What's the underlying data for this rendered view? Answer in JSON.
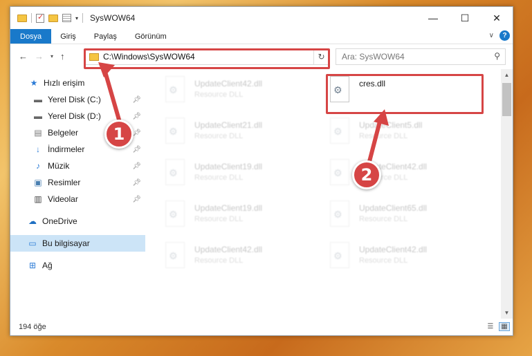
{
  "window": {
    "title": "SysWOW64",
    "controls": {
      "minimize": "—",
      "maximize": "☐",
      "close": "✕"
    }
  },
  "ribbon": {
    "tabs": [
      "Dosya",
      "Giriş",
      "Paylaş",
      "Görünüm"
    ],
    "help": "?"
  },
  "address": {
    "path": "C:\\Windows\\SysWOW64",
    "search_placeholder": "Ara: SysWOW64"
  },
  "sidebar": {
    "items": [
      {
        "label": "Hızlı erişim",
        "icon": "star-icon"
      },
      {
        "label": "Yerel Disk (C:)",
        "icon": "drive-icon"
      },
      {
        "label": "Yerel Disk (D:)",
        "icon": "drive-icon"
      },
      {
        "label": "Belgeler",
        "icon": "documents-icon"
      },
      {
        "label": "İndirmeler",
        "icon": "download-icon"
      },
      {
        "label": "Müzik",
        "icon": "music-icon"
      },
      {
        "label": "Resimler",
        "icon": "pictures-icon"
      },
      {
        "label": "Videolar",
        "icon": "videos-icon"
      },
      {
        "label": "OneDrive",
        "icon": "cloud-icon"
      },
      {
        "label": "Bu bilgisayar",
        "icon": "computer-icon"
      },
      {
        "label": "Ağ",
        "icon": "network-icon"
      }
    ]
  },
  "files": [
    {
      "name": "UpdateClient42.dll",
      "type": "Resource DLL"
    },
    {
      "name": "cres.dll",
      "type": ""
    },
    {
      "name": "UpdateClient21.dll",
      "type": "Resource DLL"
    },
    {
      "name": "UpdateClient5.dll",
      "type": "Resource DLL"
    },
    {
      "name": "UpdateClient19.dll",
      "type": "Resource DLL"
    },
    {
      "name": "UpdateClient42.dll",
      "type": "Resource DLL"
    },
    {
      "name": "UpdateClient19.dll",
      "type": "Resource DLL"
    },
    {
      "name": "UpdateClient65.dll",
      "type": "Resource DLL"
    },
    {
      "name": "UpdateClient42.dll",
      "type": "Resource DLL"
    },
    {
      "name": "UpdateClient42.dll",
      "type": "Resource DLL"
    }
  ],
  "status": {
    "count": "194 öğe"
  },
  "annotations": {
    "step1": "1",
    "step2": "2"
  },
  "colors": {
    "accent": "#1979ca",
    "highlight": "#d64545",
    "selected": "#cce4f7"
  }
}
